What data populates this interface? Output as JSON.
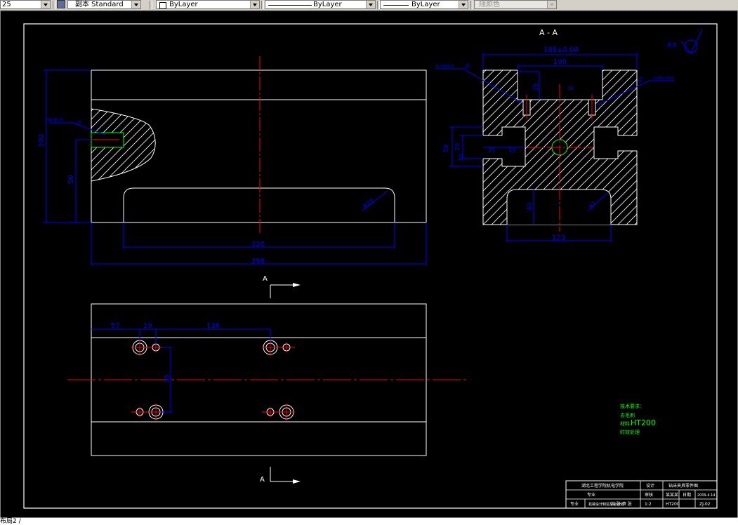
{
  "toolbar": {
    "scale_value": "25",
    "dimstyle_label": "副本 Standard",
    "layer_value": "ByLayer",
    "linetype_value": "ByLayer",
    "lineweight_value": "ByLayer",
    "color_value": "随颜色"
  },
  "section": {
    "title": "A - A",
    "roughness_text": "其余",
    "dims": {
      "top_width": "188±0.06",
      "inner_width": "100",
      "depth_35": "35",
      "depth_16": "16",
      "dim_56": "56",
      "dim_20": "20",
      "dim_30": "30",
      "dim_21": "21",
      "dim_15": "15",
      "dim_40": "40",
      "bottom_width": "123",
      "r8": "R7",
      "angle_left": "30",
      "angle_right": "15",
      "note_left": "4×M8深18",
      "note_right": "4-Ø8H7深18"
    }
  },
  "front_view": {
    "dims": {
      "height_100": "100",
      "height_50": "50",
      "slot_220": "220",
      "total_298": "298",
      "radius": "R20",
      "thread_note": "M8深18",
      "small_dim": "10"
    }
  },
  "top_view": {
    "dims": {
      "d57": "57",
      "d19": "19",
      "d136": "136",
      "d35": "35"
    },
    "section_marker_top": "A",
    "section_marker_bottom": "A"
  },
  "notes": {
    "line1": "技术要求：",
    "line2": "去毛刺",
    "line3_prefix": "材料:",
    "material": "HT200",
    "line4": "时效处理"
  },
  "title_block": {
    "school": "湖北工程学院机电学院",
    "part_name": "钻床夹具零件图",
    "design": "设计",
    "student": "某某某",
    "date_label": "日期",
    "date": "2009.4.14",
    "drawing_no": "ZJ-02",
    "scale": "1:2",
    "sheet": "共 张 第 张",
    "check": "审核",
    "material": "HT200",
    "major": "专业",
    "major_val": "机械设计制造及自动化"
  },
  "command_line": {
    "text": "布局2 /"
  }
}
